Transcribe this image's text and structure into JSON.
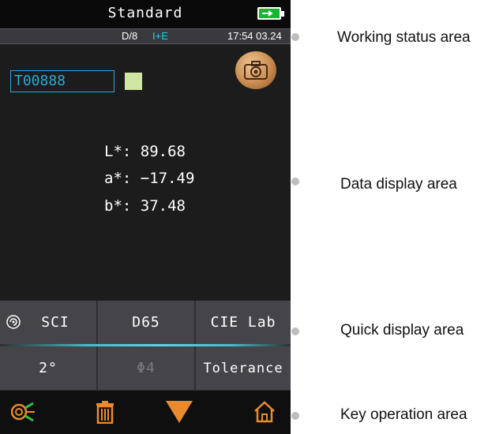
{
  "device": {
    "title": "Standard",
    "status": {
      "geometry": "D/8",
      "mode": "I+E",
      "timestamp": "17:54 03.24"
    },
    "sample_id": "T00888",
    "swatch_color": "#cfe7a2",
    "readings": {
      "L": "L*: 89.68",
      "a": "a*: −17.49",
      "b": "b*: 37.48"
    },
    "quick": {
      "sci": "SCI",
      "illuminant": "D65",
      "color_space": "CIE Lab",
      "observer": "2°",
      "aperture": "Φ4",
      "tolerance": "Tolerance"
    },
    "keys": [
      "measure-icon",
      "trash-icon",
      "down-triangle-icon",
      "home-icon"
    ],
    "accent_color": "#2aa9d9",
    "status_mode_color": "#19d0e6"
  },
  "annotations": {
    "working_status": "Working status area",
    "data_display": "Data display area",
    "quick_display": "Quick display area",
    "key_operation": "Key operation area"
  }
}
